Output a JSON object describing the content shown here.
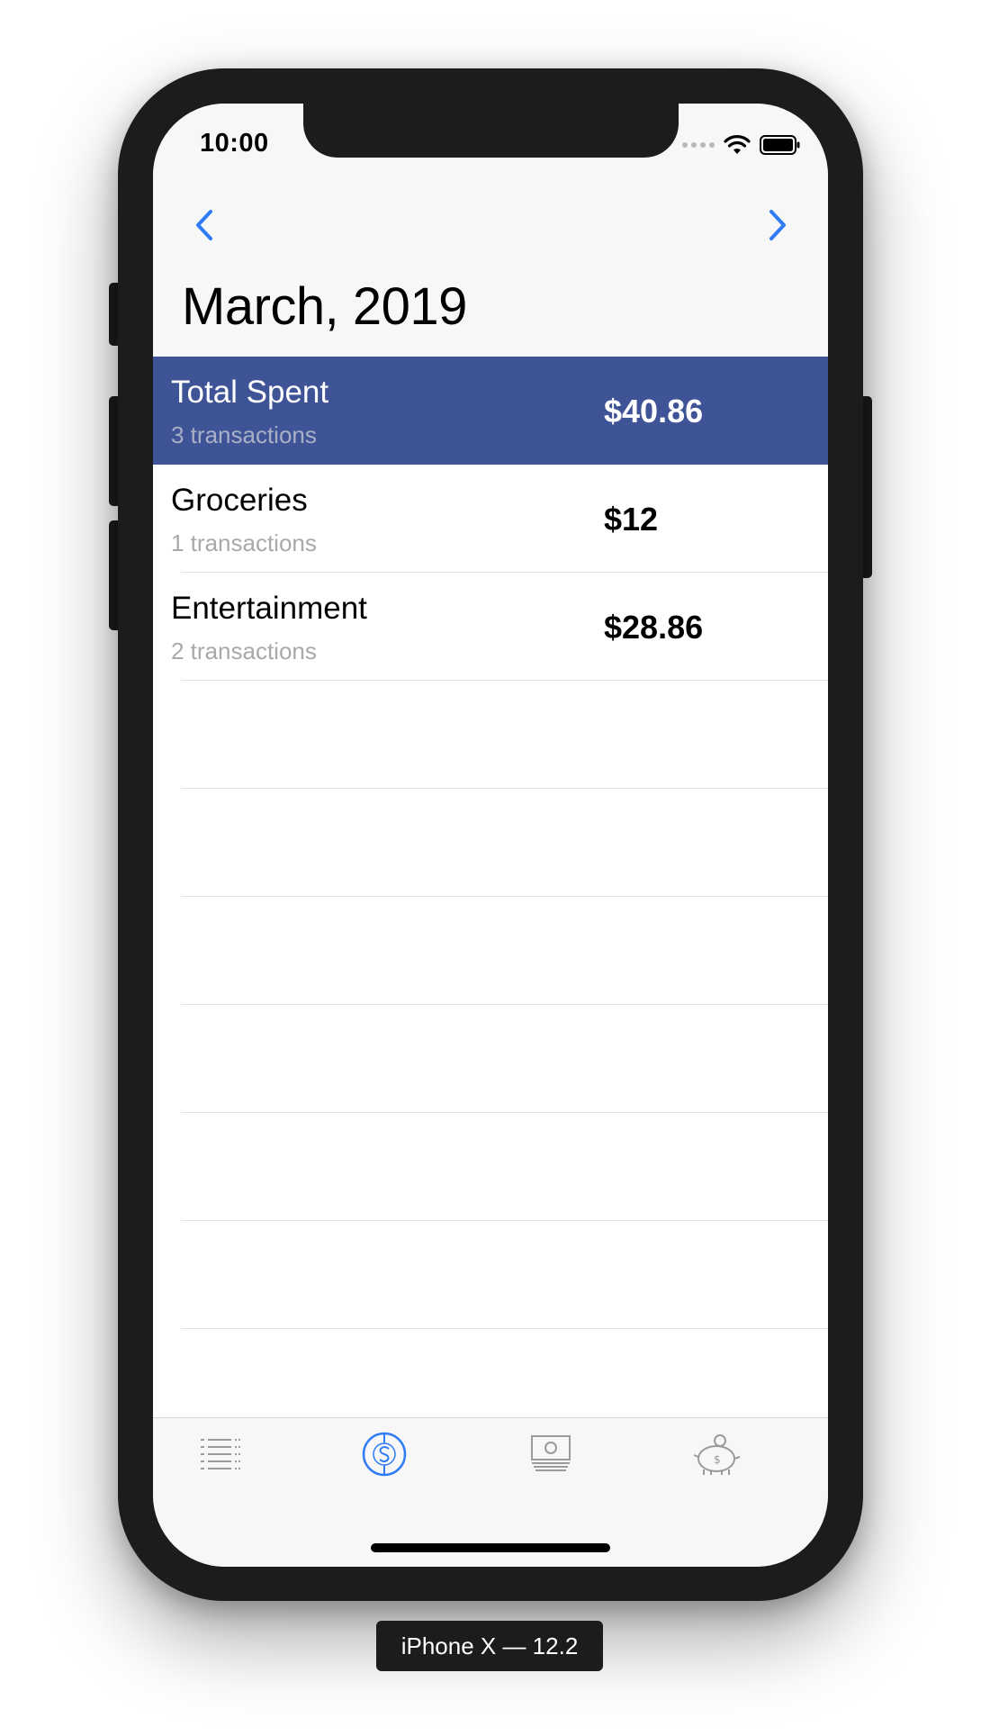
{
  "status_bar": {
    "time": "10:00"
  },
  "nav": {
    "back_icon": "chevron-left-icon",
    "forward_icon": "chevron-right-icon",
    "accent_color": "#2f7cf6"
  },
  "page": {
    "title": "March, 2019"
  },
  "summary": {
    "name": "Total Spent",
    "count": "3 transactions",
    "amount": "$40.86",
    "background_color": "#3f5497"
  },
  "categories": [
    {
      "name": "Groceries",
      "count": "1 transactions",
      "amount": "$12"
    },
    {
      "name": "Entertainment",
      "count": "2 transactions",
      "amount": "$28.86"
    }
  ],
  "tab_bar": {
    "tabs": [
      {
        "icon": "list-icon",
        "selected": false
      },
      {
        "icon": "dollar-circle-icon",
        "selected": true
      },
      {
        "icon": "cash-icon",
        "selected": false
      },
      {
        "icon": "piggy-bank-icon",
        "selected": false
      }
    ],
    "selected_color": "#2f7cf6",
    "unselected_color": "#9a9a9e"
  },
  "simulator": {
    "device_label": "iPhone X — 12.2"
  }
}
